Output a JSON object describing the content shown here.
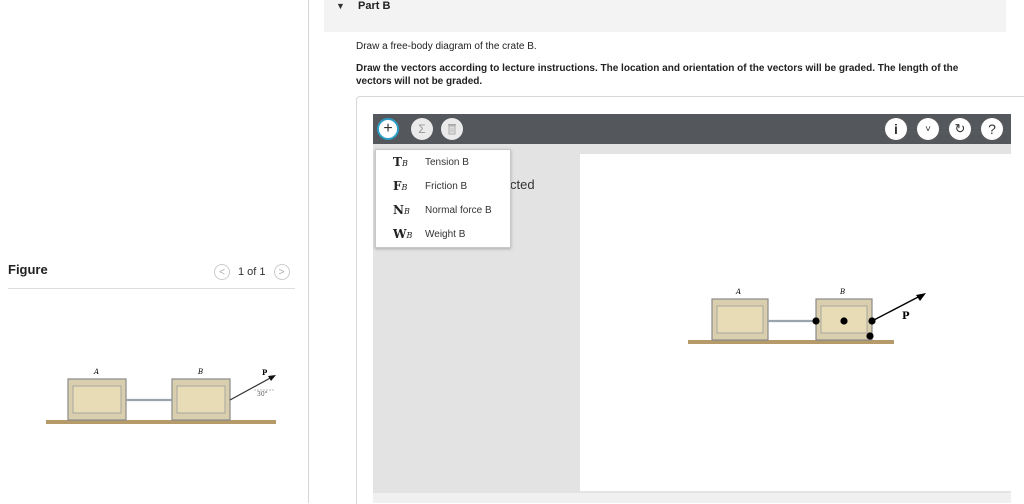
{
  "left": {
    "figure_title": "Figure",
    "pager": {
      "prev": "<",
      "label": "1 of 1",
      "next": ">"
    },
    "figure": {
      "crate_a": "A",
      "crate_b": "B",
      "force": "P",
      "angle": "30°"
    }
  },
  "part": {
    "caret": "▼",
    "label": "Part B",
    "prompt": "Draw a free-body diagram of the crate B.",
    "instructions": "Draw the vectors according to lecture instructions. The location and orientation of the vectors will be graded. The length of the vectors will not be graded."
  },
  "toolbar": {
    "add_icon": "plus-icon",
    "sum_icon": "sigma-icon",
    "trash_icon": "trash-icon",
    "info": "i",
    "chevron": "˅",
    "reset": "↻",
    "help": "?"
  },
  "menu": {
    "items": [
      {
        "symbol": "T",
        "sub": "B",
        "label": "Tension B"
      },
      {
        "symbol": "F",
        "sub": "B",
        "label": "Friction B"
      },
      {
        "symbol": "N",
        "sub": "B",
        "label": "Normal force B"
      },
      {
        "symbol": "W",
        "sub": "B",
        "label": "Weight B"
      }
    ]
  },
  "side_text": "cted",
  "diagram": {
    "crate_a": "A",
    "crate_b": "B",
    "force": "P"
  },
  "colors": {
    "toolbar": "#54575c",
    "accent": "#2e9cc5",
    "crate": "#e6d9b5",
    "floor": "#b59a6a"
  }
}
